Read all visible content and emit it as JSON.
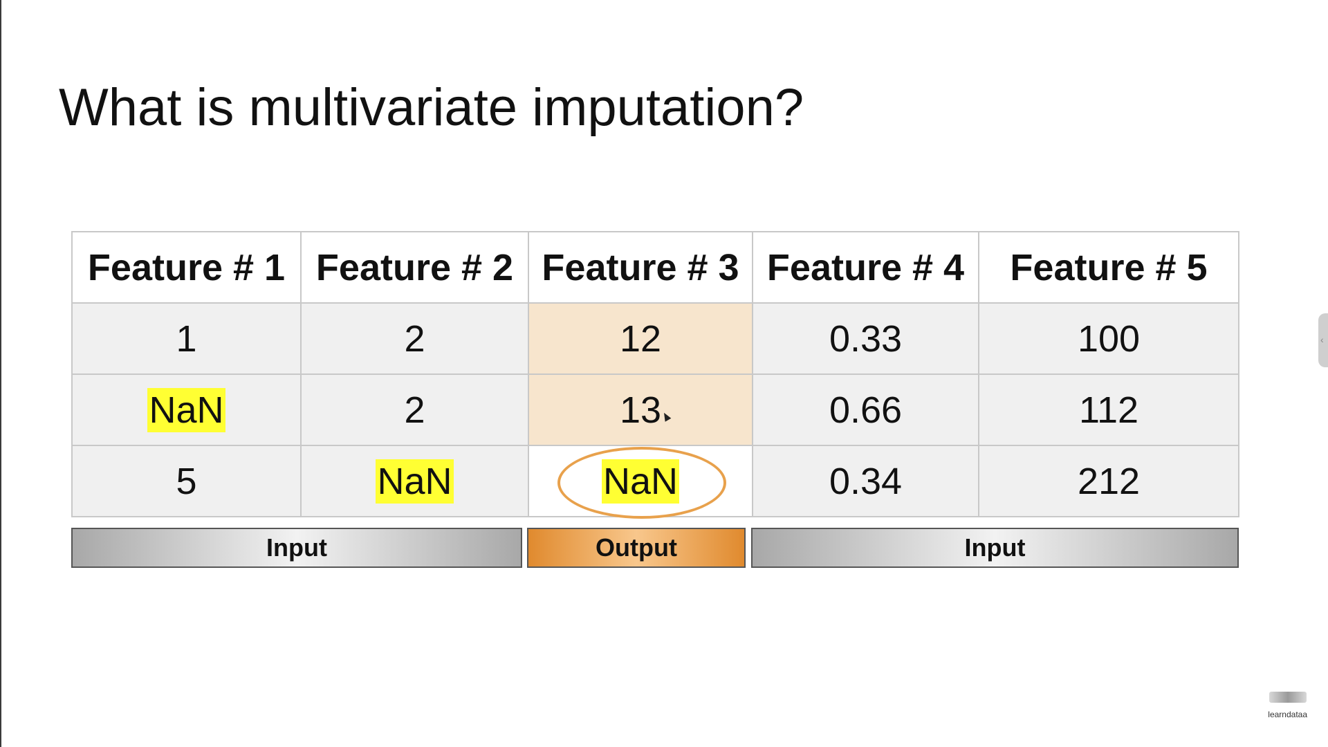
{
  "slide": {
    "title": "What is multivariate imputation?"
  },
  "table": {
    "headers": [
      "Feature # 1",
      "Feature # 2",
      "Feature # 3",
      "Feature # 4",
      "Feature # 5"
    ],
    "rows": [
      [
        "1",
        "2",
        "12",
        "0.33",
        "100"
      ],
      [
        "NaN",
        "2",
        "13",
        "0.66",
        "112"
      ],
      [
        "5",
        "NaN",
        "NaN",
        "0.34",
        "212"
      ]
    ]
  },
  "legend": {
    "left_label": "Input",
    "middle_label": "Output",
    "right_label": "Input"
  },
  "watermark": {
    "text": "learndataa"
  },
  "colors": {
    "nan_highlight": "#ffff33",
    "output_column": "#f7e5cd",
    "output_bar": "#e08a2e",
    "circle": "#e8a14c"
  }
}
